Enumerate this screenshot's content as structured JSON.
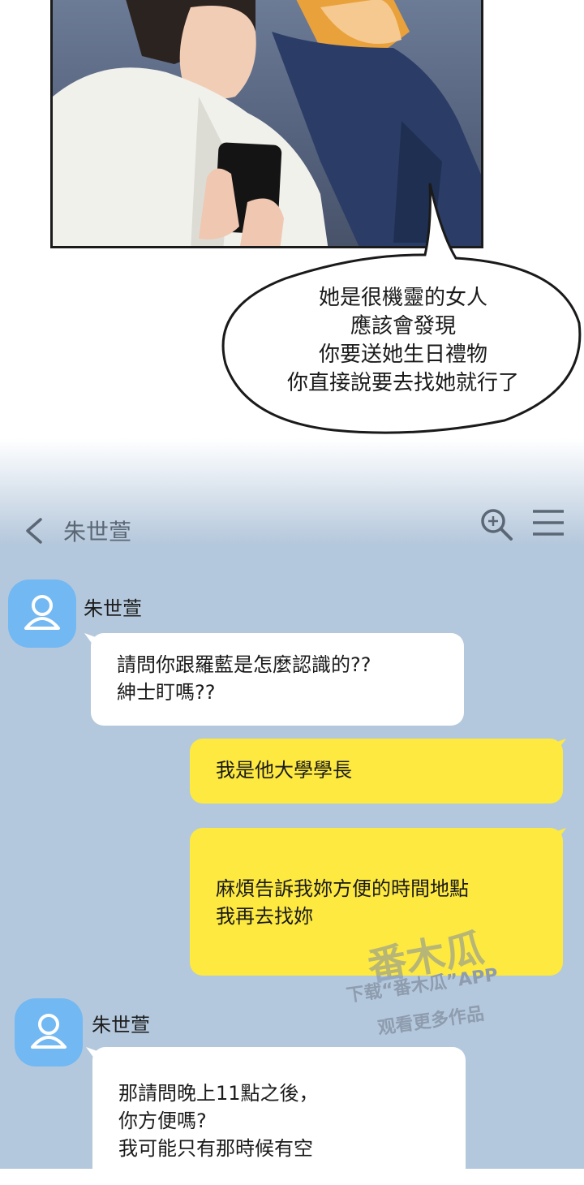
{
  "bubble": {
    "lines": [
      "她是很機靈的女人",
      "應該會發現",
      "你要送她生日禮物",
      "你直接說要去找她就行了"
    ]
  },
  "chat_header": {
    "title": "朱世萱",
    "back_icon": "chevron-left-icon",
    "search_icon": "zoom-in-icon",
    "menu_icon": "hamburger-menu-icon"
  },
  "messages": [
    {
      "type": "in",
      "sender": "朱世萱",
      "lines": [
        "請問你跟羅藍是怎麼認識的??",
        "紳士盯嗎??"
      ]
    },
    {
      "type": "out",
      "lines": [
        "我是他大學學長"
      ]
    },
    {
      "type": "out",
      "lines": [
        "麻煩告訴我妳方便的時間地點",
        "我再去找妳"
      ]
    },
    {
      "type": "in",
      "sender": "朱世萱",
      "lines": [
        "那請問晚上11點之後，",
        "你方便嗎?",
        "我可能只有那時候有空"
      ]
    }
  ],
  "watermark": {
    "logo": "番木瓜",
    "line1": "下载“番木瓜”APP",
    "line2": "观看更多作品"
  },
  "colors": {
    "chat_bg": "#b4c8dd",
    "incoming_bubble": "#ffffff",
    "outgoing_bubble": "#fde940",
    "avatar": "#72b8f2"
  }
}
